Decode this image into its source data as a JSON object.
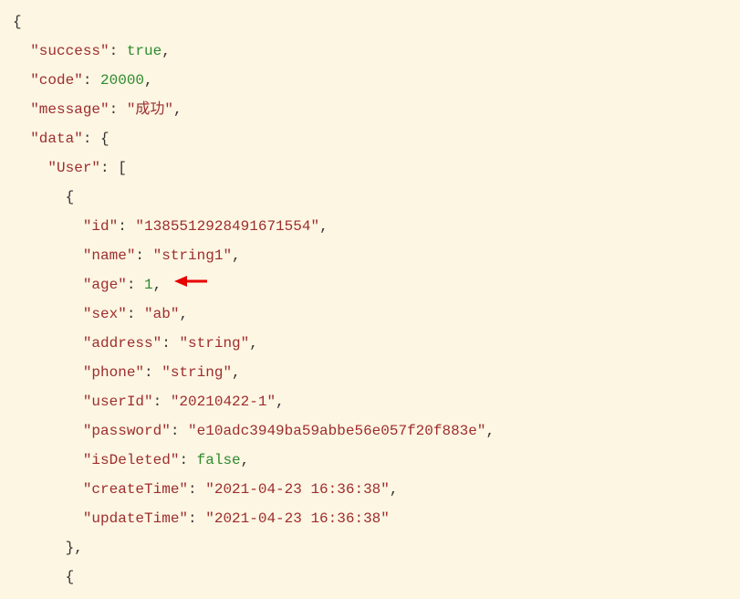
{
  "lines": {
    "open_brace": "{",
    "success_key": "\"success\"",
    "success_val": "true",
    "code_key": "\"code\"",
    "code_val": "20000",
    "message_key": "\"message\"",
    "message_val": "\"成功\"",
    "data_key": "\"data\"",
    "data_open": "{",
    "user_key": "\"User\"",
    "user_open": "[",
    "obj_open": "{",
    "id_key": "\"id\"",
    "id_val": "\"1385512928491671554\"",
    "name_key": "\"name\"",
    "name_val": "\"string1\"",
    "age_key": "\"age\"",
    "age_val": "1",
    "sex_key": "\"sex\"",
    "sex_val": "\"ab\"",
    "address_key": "\"address\"",
    "address_val": "\"string\"",
    "phone_key": "\"phone\"",
    "phone_val": "\"string\"",
    "userId_key": "\"userId\"",
    "userId_val": "\"20210422-1\"",
    "password_key": "\"password\"",
    "password_val": "\"e10adc3949ba59abbe56e057f20f883e\"",
    "isDeleted_key": "\"isDeleted\"",
    "isDeleted_val": "false",
    "createTime_key": "\"createTime\"",
    "createTime_val": "\"2021-04-23 16:36:38\"",
    "updateTime_key": "\"updateTime\"",
    "updateTime_val": "\"2021-04-23 16:36:38\"",
    "obj_close": "},",
    "obj2_open": "{"
  }
}
